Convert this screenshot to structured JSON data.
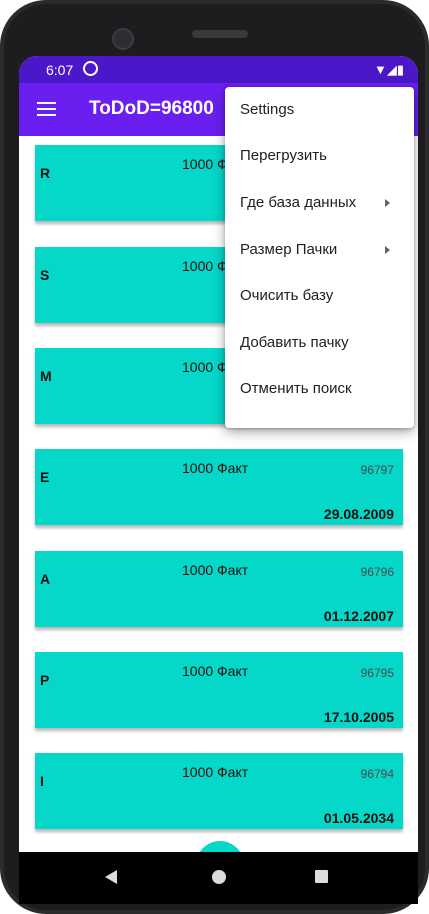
{
  "status": {
    "time": "6:07",
    "icons": "▼◢▮"
  },
  "appbar": {
    "title": "ToDoD=96800"
  },
  "cards": [
    {
      "letter": "R",
      "fact": "1000 Факт",
      "num": "",
      "date": ""
    },
    {
      "letter": "S",
      "fact": "1000 Факт",
      "num": "",
      "date": ""
    },
    {
      "letter": "M",
      "fact": "1000 Факт",
      "num": "",
      "date": ""
    },
    {
      "letter": "E",
      "fact": "1000 Факт",
      "num": "96797",
      "date": "29.08.2009"
    },
    {
      "letter": "A",
      "fact": "1000 Факт",
      "num": "96796",
      "date": "01.12.2007"
    },
    {
      "letter": "P",
      "fact": "1000 Факт",
      "num": "96795",
      "date": "17.10.2005"
    },
    {
      "letter": "I",
      "fact": "1000 Факт",
      "num": "96794",
      "date": "01.05.2034"
    }
  ],
  "menu": {
    "items": [
      {
        "label": "Settings"
      },
      {
        "label": "Перегрузить"
      },
      {
        "label": "Где база данных"
      },
      {
        "label": "Размер Пачки"
      },
      {
        "label": "Очисить базу"
      },
      {
        "label": "Добавить пачку"
      },
      {
        "label": "Отменить поиск"
      }
    ]
  },
  "colors": {
    "statusbar": "#4a18c9",
    "appbar": "#6a1ff0",
    "card": "#05d7c8"
  }
}
